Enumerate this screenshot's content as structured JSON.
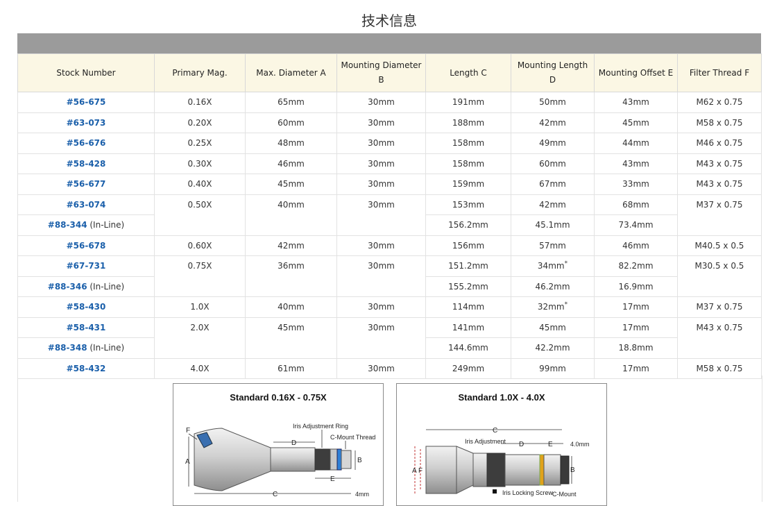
{
  "page_title": "技术信息",
  "table": {
    "headers": [
      "Stock Number",
      "Primary Mag.",
      "Max. Diameter A",
      "Mounting Diameter B",
      "Length C",
      "Mounting Length D",
      "Mounting Offset E",
      "Filter Thread F"
    ],
    "rows": [
      {
        "stock": "#56-675",
        "suffix": "",
        "mag": "0.16X",
        "diaA": "65mm",
        "diaB": "30mm",
        "lenC": "191mm",
        "lenD": "50mm",
        "offE": "43mm",
        "thrF": "M62 x 0.75"
      },
      {
        "stock": "#63-073",
        "suffix": "",
        "mag": "0.20X",
        "diaA": "60mm",
        "diaB": "30mm",
        "lenC": "188mm",
        "lenD": "42mm",
        "offE": "45mm",
        "thrF": "M58 x 0.75"
      },
      {
        "stock": "#56-676",
        "suffix": "",
        "mag": "0.25X",
        "diaA": "48mm",
        "diaB": "30mm",
        "lenC": "158mm",
        "lenD": "49mm",
        "offE": "44mm",
        "thrF": "M46 x 0.75"
      },
      {
        "stock": "#58-428",
        "suffix": "",
        "mag": "0.30X",
        "diaA": "46mm",
        "diaB": "30mm",
        "lenC": "158mm",
        "lenD": "60mm",
        "offE": "43mm",
        "thrF": "M43 x 0.75"
      },
      {
        "stock": "#56-677",
        "suffix": "",
        "mag": "0.40X",
        "diaA": "45mm",
        "diaB": "30mm",
        "lenC": "159mm",
        "lenD": "67mm",
        "offE": "33mm",
        "thrF": "M43 x 0.75"
      },
      {
        "stock": "#63-074",
        "suffix": "",
        "mag": "0.50X",
        "diaA": "40mm",
        "diaB": "30mm",
        "lenC": "153mm",
        "lenD": "42mm",
        "offE": "68mm",
        "thrF": "M37 x 0.75"
      },
      {
        "stock": "#88-344",
        "suffix": " (In-Line)",
        "lenC": "156.2mm",
        "lenD": "45.1mm",
        "offE": "73.4mm"
      },
      {
        "stock": "#56-678",
        "suffix": "",
        "mag": "0.60X",
        "diaA": "42mm",
        "diaB": "30mm",
        "lenC": "156mm",
        "lenD": "57mm",
        "offE": "46mm",
        "thrF": "M40.5 x 0.5"
      },
      {
        "stock": "#67-731",
        "suffix": "",
        "mag": "0.75X",
        "diaA": "36mm",
        "diaB": "30mm",
        "lenC": "151.2mm",
        "lenD": "34mm",
        "lenD_mark": "*",
        "offE": "82.2mm",
        "thrF": "M30.5 x 0.5"
      },
      {
        "stock": "#88-346",
        "suffix": " (In-Line)",
        "lenC": "155.2mm",
        "lenD": "46.2mm",
        "offE": "16.9mm"
      },
      {
        "stock": "#58-430",
        "suffix": "",
        "mag": "1.0X",
        "diaA": "40mm",
        "diaB": "30mm",
        "lenC": "114mm",
        "lenD": "32mm",
        "lenD_mark": "*",
        "offE": "17mm",
        "thrF": "M37 x 0.75"
      },
      {
        "stock": "#58-431",
        "suffix": "",
        "mag": "2.0X",
        "diaA": "45mm",
        "diaB": "30mm",
        "lenC": "141mm",
        "lenD": "45mm",
        "offE": "17mm",
        "thrF": "M43 x 0.75"
      },
      {
        "stock": "#88-348",
        "suffix": " (In-Line)",
        "lenC": "144.6mm",
        "lenD": "42.2mm",
        "offE": "18.8mm"
      },
      {
        "stock": "#58-432",
        "suffix": "",
        "mag": "4.0X",
        "diaA": "61mm",
        "diaB": "30mm",
        "lenC": "249mm",
        "lenD": "99mm",
        "offE": "17mm",
        "thrF": "M58 x 0.75"
      }
    ]
  },
  "diagrams": {
    "left": {
      "title": "Standard 0.16X - 0.75X",
      "labels": {
        "f": "F",
        "iris_ring": "Iris Adjustment Ring",
        "cmount_thread": "C-Mount Thread",
        "d": "D",
        "a": "A",
        "b": "B",
        "e": "E",
        "c": "C",
        "mm4": "4mm"
      }
    },
    "right": {
      "title": "Standard 1.0X - 4.0X",
      "labels": {
        "c": "C",
        "iris": "Iris Adjustment",
        "d": "D",
        "e": "E",
        "mm4": "4.0mm",
        "a": "A",
        "f": "F",
        "b": "B",
        "screw": "Iris Locking Screw",
        "cmount": "C-Mount"
      }
    }
  }
}
